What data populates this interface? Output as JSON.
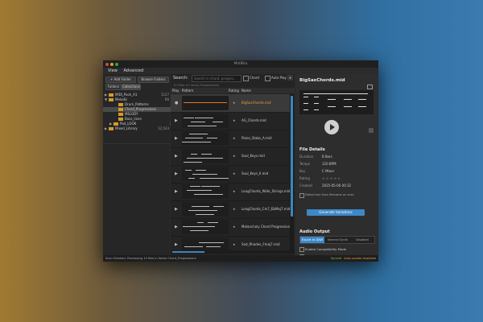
{
  "window": {
    "title": "MidiBro"
  },
  "menu": {
    "view": "View",
    "advanced": "Advanced"
  },
  "left": {
    "add_folder": "+ Add Folder",
    "browse_folders": "Browse Folders",
    "tab_folders": "Folders",
    "tab_collections": "Collections",
    "tree": [
      {
        "label": "MIDI_Pack_A1",
        "count": "1127",
        "indent": 0,
        "arrow": "▶"
      },
      {
        "label": "Melodic",
        "count": "66",
        "indent": 0,
        "arrow": "▼"
      },
      {
        "label": "Drum_Patterns",
        "count": "24",
        "indent": 2,
        "arrow": ""
      },
      {
        "label": "Chord_Progressions",
        "count": "15",
        "indent": 2,
        "arrow": "",
        "selected": true
      },
      {
        "label": "MELODY",
        "count": "41",
        "indent": 2,
        "arrow": ""
      },
      {
        "label": "Bass_lines",
        "count": "12",
        "indent": 2,
        "arrow": ""
      },
      {
        "label": "Pad_LOOK",
        "count": "21",
        "indent": 1,
        "arrow": "▶"
      },
      {
        "label": "Mixed_Library",
        "count": "12,543",
        "indent": 0,
        "arrow": "▶"
      }
    ]
  },
  "middle": {
    "search_label": "Search:",
    "search_placeholder": "Search in chord, progres...",
    "chord_label": "Chord",
    "auto_play_label": "Auto Play",
    "status_line": "15 Files in Chord_Progressions",
    "col_play": "Play",
    "col_pattern": "Pattern",
    "col_rating": "Rating",
    "col_name": "Name",
    "rows": [
      "BigSaxChords.mid",
      "AG_Chords.mid",
      "Piano_Stabs_A.mid",
      "Soul_Keys.mid",
      "Soul_Keys_II.mid",
      "LongChords_Wide_Strings.mid",
      "LongChords_Cm7_EbMaj7.mid",
      "Melancholy Chord Progression.mid",
      "Sad_Rhodes_Fmaj7.mid",
      "Rich_Strings_Cmaj9.mid",
      "Progressions_Dorian.mid",
      "Synth_Chord_Prog_Am.mid"
    ]
  },
  "right": {
    "file_title": "BigSaxChords.mid",
    "details_header": "File Details",
    "details": [
      {
        "k": "Duration",
        "v": "8 Bars"
      },
      {
        "k": "Tempo",
        "v": "120 BPM"
      },
      {
        "k": "Key",
        "v": "C Minor"
      },
      {
        "k": "Rating",
        "v": "☆ ☆ ☆ ☆ ☆"
      },
      {
        "k": "Created",
        "v": "2025-05-06 00:32"
      }
    ],
    "check_label": "Detect key from filename on scan",
    "generate_button": "Generate Variations",
    "audio_header": "Audio Output",
    "audio_tabs": [
      "Export to DAW",
      "Internal Synth",
      "Disabled"
    ],
    "audio_checks": [
      "Enable Compatibility Mode",
      "Sync to DAW"
    ]
  },
  "statusbar": {
    "left": "Scan Finished. Processing 15 files in folder Chord_Progressions",
    "right_green": "Synced",
    "right_orange": "Auto-update Available"
  }
}
